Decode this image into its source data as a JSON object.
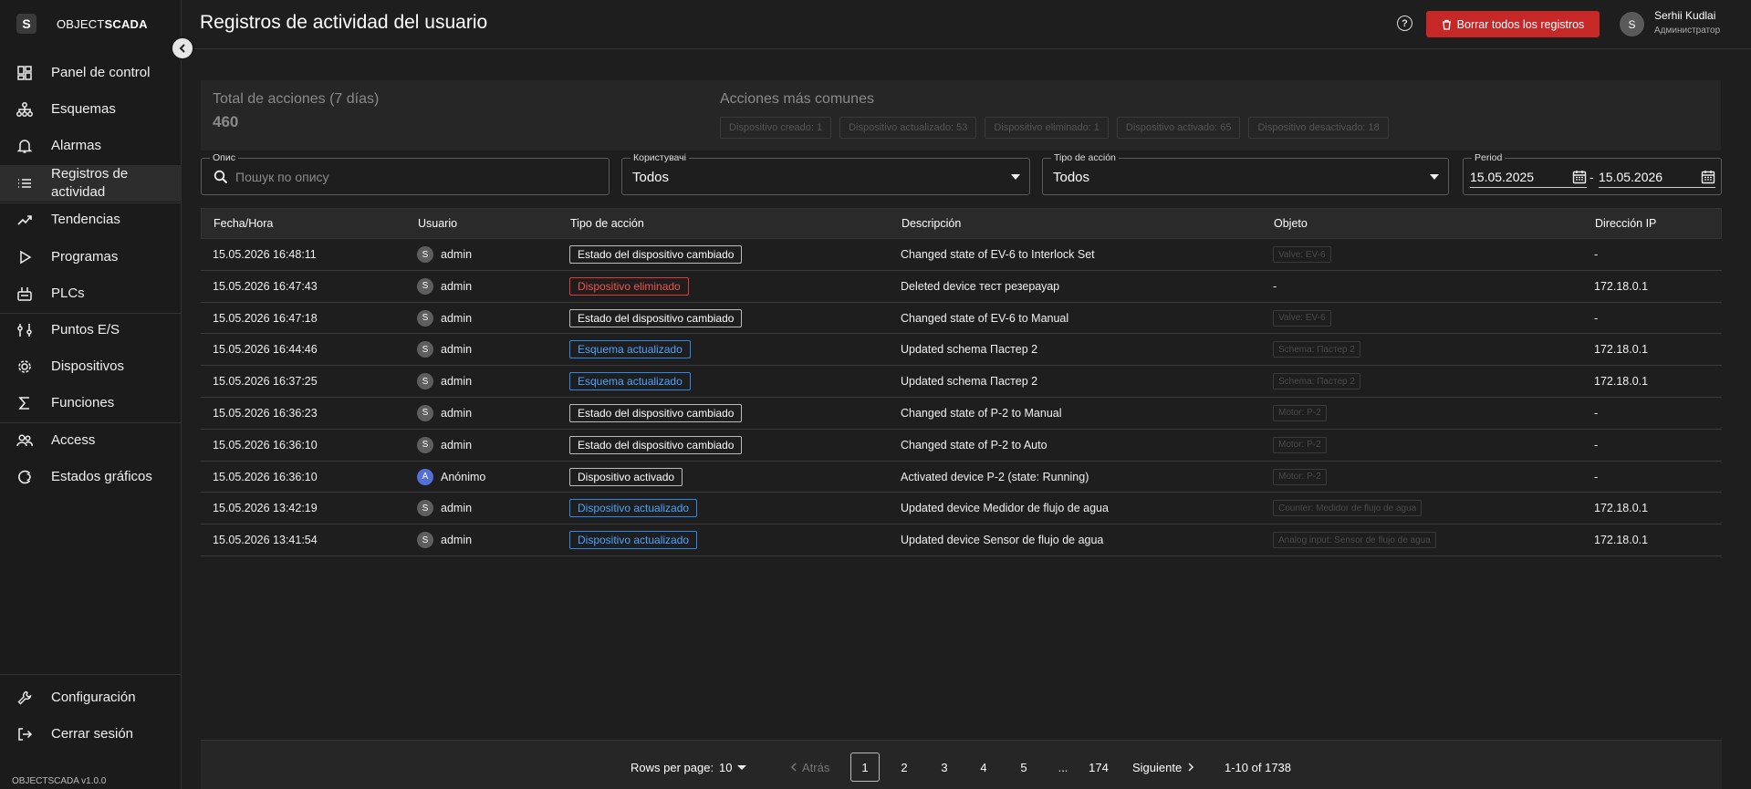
{
  "app": {
    "logo_letter": "S",
    "logo_text_light": "OBJECT",
    "logo_text_bold": "SCADA",
    "version": "OBJECTSCADA v1.0.0"
  },
  "sidebar": {
    "items": [
      {
        "label": "Panel de control",
        "icon": "dashboard-icon"
      },
      {
        "label": "Esquemas",
        "icon": "schema-icon"
      },
      {
        "label": "Alarmas",
        "icon": "bell-icon"
      },
      {
        "label": "Registros de actividad",
        "icon": "list-icon",
        "active": true
      },
      {
        "label": "Tendencias",
        "icon": "trend-icon"
      },
      {
        "label": "Programas",
        "icon": "play-icon"
      },
      {
        "label": "PLCs",
        "icon": "plc-icon"
      },
      {
        "label": "Puntos E/S",
        "icon": "io-points-icon"
      },
      {
        "label": "Dispositivos",
        "icon": "device-icon"
      },
      {
        "label": "Funciones",
        "icon": "sigma-icon"
      },
      {
        "label": "Access",
        "icon": "users-icon"
      },
      {
        "label": "Estados gráficos",
        "icon": "graphic-states-icon"
      }
    ],
    "bottom": [
      {
        "label": "Configuración",
        "icon": "wrench-icon"
      },
      {
        "label": "Cerrar sesión",
        "icon": "logout-icon"
      }
    ]
  },
  "header": {
    "title": "Registros de actividad del usuario",
    "clear_button": "Borrar todos los registros",
    "user_initial": "S",
    "user_name": "Serhii Kudlai",
    "user_role": "Администратор"
  },
  "stats": {
    "total_title": "Total de acciones (7 días)",
    "total_value": "460",
    "common_title": "Acciones más comunes",
    "chips": [
      "Dispositivo creado: 1",
      "Dispositivo actualizado: 53",
      "Dispositivo eliminado: 1",
      "Dispositivo activado: 65",
      "Dispositivo desactivado: 18"
    ]
  },
  "filters": {
    "search_label": "Опис",
    "search_placeholder": "Пошук по опису",
    "users_label": "Користувачі",
    "users_value": "Todos",
    "action_label": "Tipo de acción",
    "action_value": "Todos",
    "period_label": "Period",
    "date_from": "15.05.2025",
    "date_sep": "-",
    "date_to": "15.05.2026"
  },
  "table": {
    "columns": [
      "Fecha/Hora",
      "Usuario",
      "Tipo de acción",
      "Descripción",
      "Objeto",
      "Dirección IP"
    ],
    "rows": [
      {
        "time": "15.05.2026 16:48:11",
        "user": "admin",
        "initial": "S",
        "action": "Estado del dispositivo cambiado",
        "kind": "default",
        "desc": "Changed state of EV-6 to Interlock Set",
        "object": "Valve: EV-6",
        "ip": "-"
      },
      {
        "time": "15.05.2026 16:47:43",
        "user": "admin",
        "initial": "S",
        "action": "Dispositivo eliminado",
        "kind": "red",
        "desc": "Deleted device тест резерауар",
        "object": "",
        "object_dash": "-",
        "ip": "172.18.0.1"
      },
      {
        "time": "15.05.2026 16:47:18",
        "user": "admin",
        "initial": "S",
        "action": "Estado del dispositivo cambiado",
        "kind": "default",
        "desc": "Changed state of EV-6 to Manual",
        "object": "Valve: EV-6",
        "ip": "-"
      },
      {
        "time": "15.05.2026 16:44:46",
        "user": "admin",
        "initial": "S",
        "action": "Esquema actualizado",
        "kind": "blue",
        "desc": "Updated schema Пастер 2",
        "object": "Schema: Пастер 2",
        "ip": "172.18.0.1"
      },
      {
        "time": "15.05.2026 16:37:25",
        "user": "admin",
        "initial": "S",
        "action": "Esquema actualizado",
        "kind": "blue",
        "desc": "Updated schema Пастер 2",
        "object": "Schema: Пастер 2",
        "ip": "172.18.0.1"
      },
      {
        "time": "15.05.2026 16:36:23",
        "user": "admin",
        "initial": "S",
        "action": "Estado del dispositivo cambiado",
        "kind": "default",
        "desc": "Changed state of P-2 to Manual",
        "object": "Motor: P-2",
        "ip": "-"
      },
      {
        "time": "15.05.2026 16:36:10",
        "user": "admin",
        "initial": "S",
        "action": "Estado del dispositivo cambiado",
        "kind": "default",
        "desc": "Changed state of P-2 to Auto",
        "object": "Motor: P-2",
        "ip": "-"
      },
      {
        "time": "15.05.2026 16:36:10",
        "user": "Anónimo",
        "initial": "A",
        "avatar_color": "blue",
        "action": "Dispositivo activado",
        "kind": "default",
        "desc": "Activated device P-2 (state: Running)",
        "object": "Motor: P-2",
        "ip": "-"
      },
      {
        "time": "15.05.2026 13:42:19",
        "user": "admin",
        "initial": "S",
        "action": "Dispositivo actualizado",
        "kind": "blue",
        "desc": "Updated device Medidor de flujo de agua",
        "object": "Counter: Medidor de flujo de agua",
        "ip": "172.18.0.1"
      },
      {
        "time": "15.05.2026 13:41:54",
        "user": "admin",
        "initial": "S",
        "action": "Dispositivo actualizado",
        "kind": "blue",
        "desc": "Updated device Sensor de flujo de agua",
        "object": "Analog input: Sensor de flujo de agua",
        "ip": "172.18.0.1"
      }
    ]
  },
  "pagination": {
    "rows_per_page_label": "Rows per page:",
    "rows_per_page": "10",
    "prev": "Atrás",
    "pages": [
      "1",
      "2",
      "3",
      "4",
      "5",
      "...",
      "174"
    ],
    "current": "1",
    "next": "Siguiente",
    "range": "1-10 of 1738"
  },
  "colors": {
    "danger": "#c62828",
    "badge_blue": "#2e88e6",
    "badge_red": "#e53935"
  }
}
